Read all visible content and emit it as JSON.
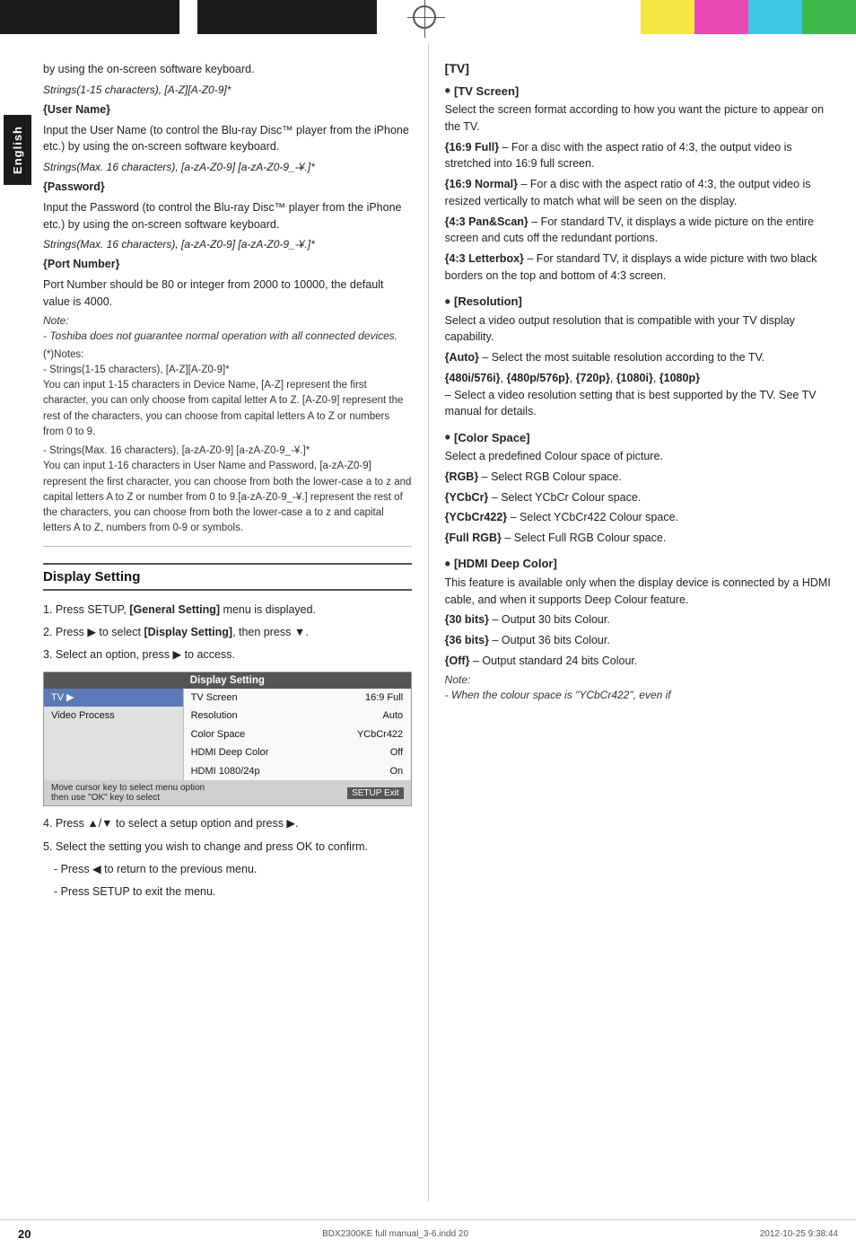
{
  "header": {
    "target_circle": true,
    "color_blocks": [
      "black",
      "black",
      "white",
      "yellow",
      "magenta",
      "cyan",
      "green"
    ]
  },
  "sidebar": {
    "label": "English"
  },
  "left_col": {
    "intro_text": "by using the on-screen software keyboard.",
    "strings_note_1": "Strings(1-15 characters), [A-Z][A-Z0-9]*",
    "user_name_label": "{User Name}",
    "user_name_desc": "Input the User Name (to control the Blu-ray Disc™ player from the iPhone etc.) by using the on-screen software keyboard.",
    "strings_note_2": "Strings(Max. 16 characters), [a-zA-Z0-9] [a-zA-Z0-9_-¥.]*",
    "password_label": "{Password}",
    "password_desc": "Input the Password (to control the Blu-ray Disc™ player from the iPhone etc.) by using the on-screen software keyboard.",
    "strings_note_3": "Strings(Max. 16 characters), [a-zA-Z0-9] [a-zA-Z0-9_-¥.]*",
    "port_label": "{Port Number}",
    "port_desc": "Port Number should be 80 or integer from 2000 to 10000, the default value is 4000.",
    "note_label": "Note:",
    "note_text": "- Toshiba does not guarantee normal operation with all connected devices.",
    "asterisk_notes_title": "    (*)Notes:",
    "asterisk_note_1": "- Strings(1-15 characters), [A-Z][A-Z0-9]*\nYou can input 1-15 characters in Device Name, [A-Z] represent the first character, you can only choose from capital letter A to Z. [A-Z0-9] represent the rest of the characters, you can choose from capital letters A to Z or numbers from 0 to 9.",
    "asterisk_note_2": "- Strings(Max. 16 characters), [a-zA-Z0-9] [a-zA-Z0-9_-¥.]*\nYou can input 1-16 characters in User Name and Password, [a-zA-Z0-9] represent the first character, you can choose from both the lower-case a to z and capital letters A to Z or number from 0 to 9.[a-zA-Z0-9_-¥.] represent the rest of the characters, you can choose from both the lower-case a to z and capital letters A to Z, numbers from 0-9 or symbols.",
    "section_heading": "Display Setting",
    "step1": "1. Press SETUP, [General Setting] menu is displayed.",
    "step1_bold": "[General Setting]",
    "step2": "2. Press ▶ to select [Display Setting], then press ▼.",
    "step2_bold": "[Display Setting]",
    "step3": "3. Select an option, press ▶ to access.",
    "menu": {
      "title": "Display Setting",
      "rows": [
        {
          "left": "TV",
          "left_selected": true,
          "mid": "TV Screen",
          "right": "16:9 Full"
        },
        {
          "left": "Video Process",
          "left_selected": false,
          "mid": "Resolution",
          "right": "Auto"
        },
        {
          "left": "",
          "left_selected": false,
          "mid": "Color Space",
          "right": "YCbCr422"
        },
        {
          "left": "",
          "left_selected": false,
          "mid": "HDMI Deep Color",
          "right": "Off"
        },
        {
          "left": "",
          "left_selected": false,
          "mid": "HDMI 1080/24p",
          "right": "On"
        }
      ],
      "footer_left": "Move cursor key to select menu option\nthen use \"OK\" key to select",
      "footer_right": "SETUP Exit"
    },
    "step4": "4. Press ▲/▼ to select a setup option and press ▶.",
    "step5_intro": "5. Select the setting you wish to change and press OK to confirm.",
    "step5_a": "- Press ◀ to return to the previous menu.",
    "step5_b": "- Press SETUP to exit the menu."
  },
  "right_col": {
    "tv_section_label": "[TV]",
    "bullets": [
      {
        "title": "[TV Screen]",
        "desc": "Select the screen format according to how you want the picture to appear on the TV.",
        "options": [
          {
            "label": "{16:9 Full}",
            "desc": "– For a disc with the aspect ratio of 4:3, the output video is stretched into 16:9 full screen."
          },
          {
            "label": "{16:9 Normal}",
            "desc": "– For a disc with the aspect ratio of 4:3, the output video is resized vertically to match what will be seen on the display."
          },
          {
            "label": "{4:3 Pan&Scan}",
            "desc": "– For standard TV, it displays a wide picture on the entire screen and cuts off the redundant portions."
          },
          {
            "label": "{4:3 Letterbox}",
            "desc": "– For standard TV, it displays a wide picture with two black borders on the top and bottom of 4:3 screen."
          }
        ]
      },
      {
        "title": "[Resolution]",
        "desc": "Select a video output resolution that is compatible with your TV display capability.",
        "options": [
          {
            "label": "{Auto}",
            "desc": "– Select the most suitable resolution according to the TV."
          },
          {
            "label": "{480i/576i}, {480p/576p}, {720p}, {1080i}, {1080p}",
            "desc": "– Select a video resolution setting that is best supported by the TV. See TV manual for details."
          }
        ]
      },
      {
        "title": "[Color Space]",
        "desc": "Select a predefined Colour space of picture.",
        "options": [
          {
            "label": "{RGB}",
            "desc": "– Select RGB Colour space."
          },
          {
            "label": "{YCbCr}",
            "desc": "– Select YCbCr Colour space."
          },
          {
            "label": "{YCbCr422}",
            "desc": "– Select YCbCr422 Colour space."
          },
          {
            "label": "{Full RGB}",
            "desc": "– Select Full RGB Colour space."
          }
        ]
      },
      {
        "title": "[HDMI Deep Color]",
        "desc": "This feature is available only when the display device is connected by a HDMI cable, and when it supports Deep Colour feature.",
        "options": [
          {
            "label": "{30 bits}",
            "desc": "– Output 30 bits Colour."
          },
          {
            "label": "{36 bits}",
            "desc": "– Output 36 bits Colour."
          },
          {
            "label": "{Off}",
            "desc": "– Output standard 24 bits Colour."
          }
        ],
        "note": "Note:\n- When the colour space is \"YCbCr422\", even if"
      }
    ]
  },
  "footer": {
    "page_number": "20",
    "file_info": "BDX2300KE full manual_3-6.indd   20",
    "date_info": "2012-10-25   9:38:44"
  }
}
